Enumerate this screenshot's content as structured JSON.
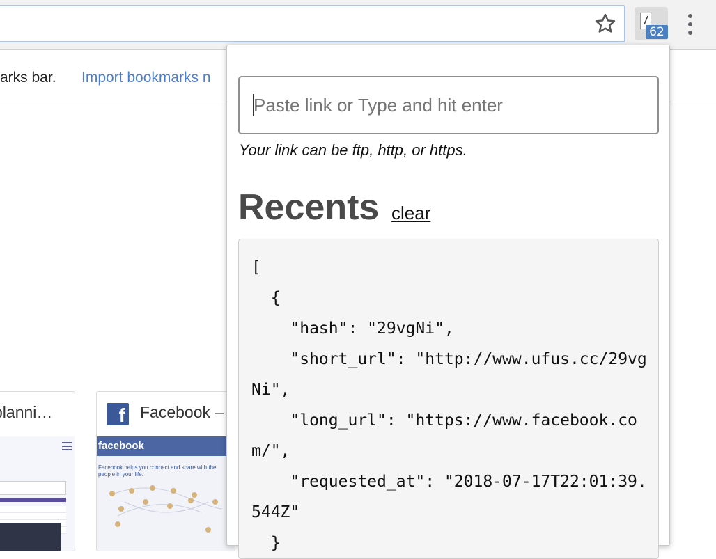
{
  "toolbar": {
    "extension_badge": "62"
  },
  "bookmarks_bar": {
    "text": "arks bar.",
    "import_link": "Import bookmarks n"
  },
  "tiles": [
    {
      "title": "planni…"
    },
    {
      "title": "Facebook –",
      "logo_letter": "f",
      "thumb_header": "facebook",
      "thumb_caption": "Facebook helps you connect and share with the people in your life."
    }
  ],
  "popup": {
    "input_placeholder": "Paste link or Type and hit enter",
    "input_value": "",
    "hint": "Your link can be ftp, http, or https.",
    "recents_heading": "Recents",
    "clear_label": "clear",
    "recents_json": "[\n  {\n    \"hash\": \"29vgNi\",\n    \"short_url\": \"http://www.ufus.cc/29vgNi\",\n    \"long_url\": \"https://www.facebook.com/\",\n    \"requested_at\": \"2018-07-17T22:01:39.544Z\"\n  }"
  },
  "colors": {
    "accent_link": "#4d7fd1",
    "badge_bg": "#4a7fc1",
    "heading_gray": "#4a4a4a",
    "facebook_blue": "#3b5998"
  },
  "icons": [
    "star-icon",
    "extension-icon",
    "menu-icon",
    "facebook-logo-icon",
    "hamburger-icon"
  ]
}
